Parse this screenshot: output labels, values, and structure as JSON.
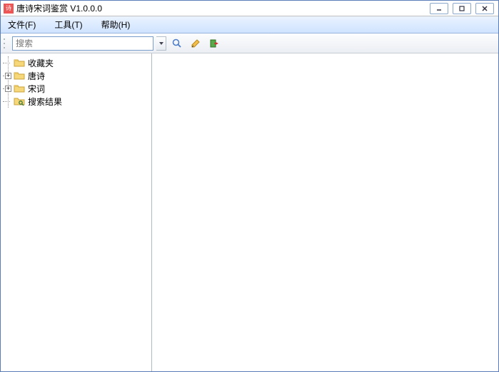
{
  "window": {
    "title": "唐诗宋词鉴赏 V1.0.0.0"
  },
  "menu": {
    "file": "文件(F)",
    "tools": "工具(T)",
    "help": "帮助(H)"
  },
  "toolbar": {
    "search_placeholder": "搜索"
  },
  "tree": {
    "favorites": "收藏夹",
    "tang": "唐诗",
    "song": "宋词",
    "results": "搜索结果"
  }
}
